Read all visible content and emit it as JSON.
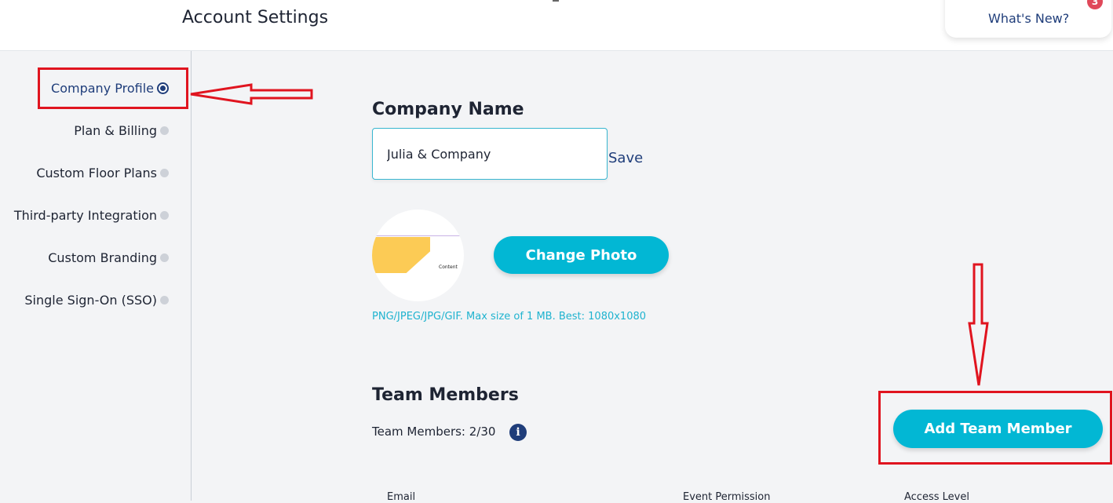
{
  "header": {
    "title": "Account Settings",
    "whats_new_label": "What's New?",
    "notification_count": "3"
  },
  "sidebar": {
    "items": [
      {
        "label": "Company Profile",
        "active": true
      },
      {
        "label": "Plan & Billing",
        "active": false
      },
      {
        "label": "Custom Floor Plans",
        "active": false
      },
      {
        "label": "Third-party Integration",
        "active": false
      },
      {
        "label": "Custom Branding",
        "active": false
      },
      {
        "label": "Single Sign-On (SSO)",
        "active": false
      }
    ]
  },
  "company": {
    "section_title": "Company Name",
    "name_value": "Julia & Company",
    "save_label": "Save",
    "change_photo_label": "Change Photo",
    "photo_hint": "PNG/JPEG/JPG/GIF. Max size of 1 MB. Best: 1080x1080",
    "avatar_text": "Content"
  },
  "team": {
    "section_title": "Team Members",
    "count_text": "Team Members: 2/30",
    "add_button_label": "Add Team Member",
    "columns": [
      "Email",
      "Event Permission",
      "Access Level"
    ]
  },
  "colors": {
    "accent": "#02b7d4",
    "navy": "#1f3d7a",
    "annotation_red": "#e0141f"
  }
}
